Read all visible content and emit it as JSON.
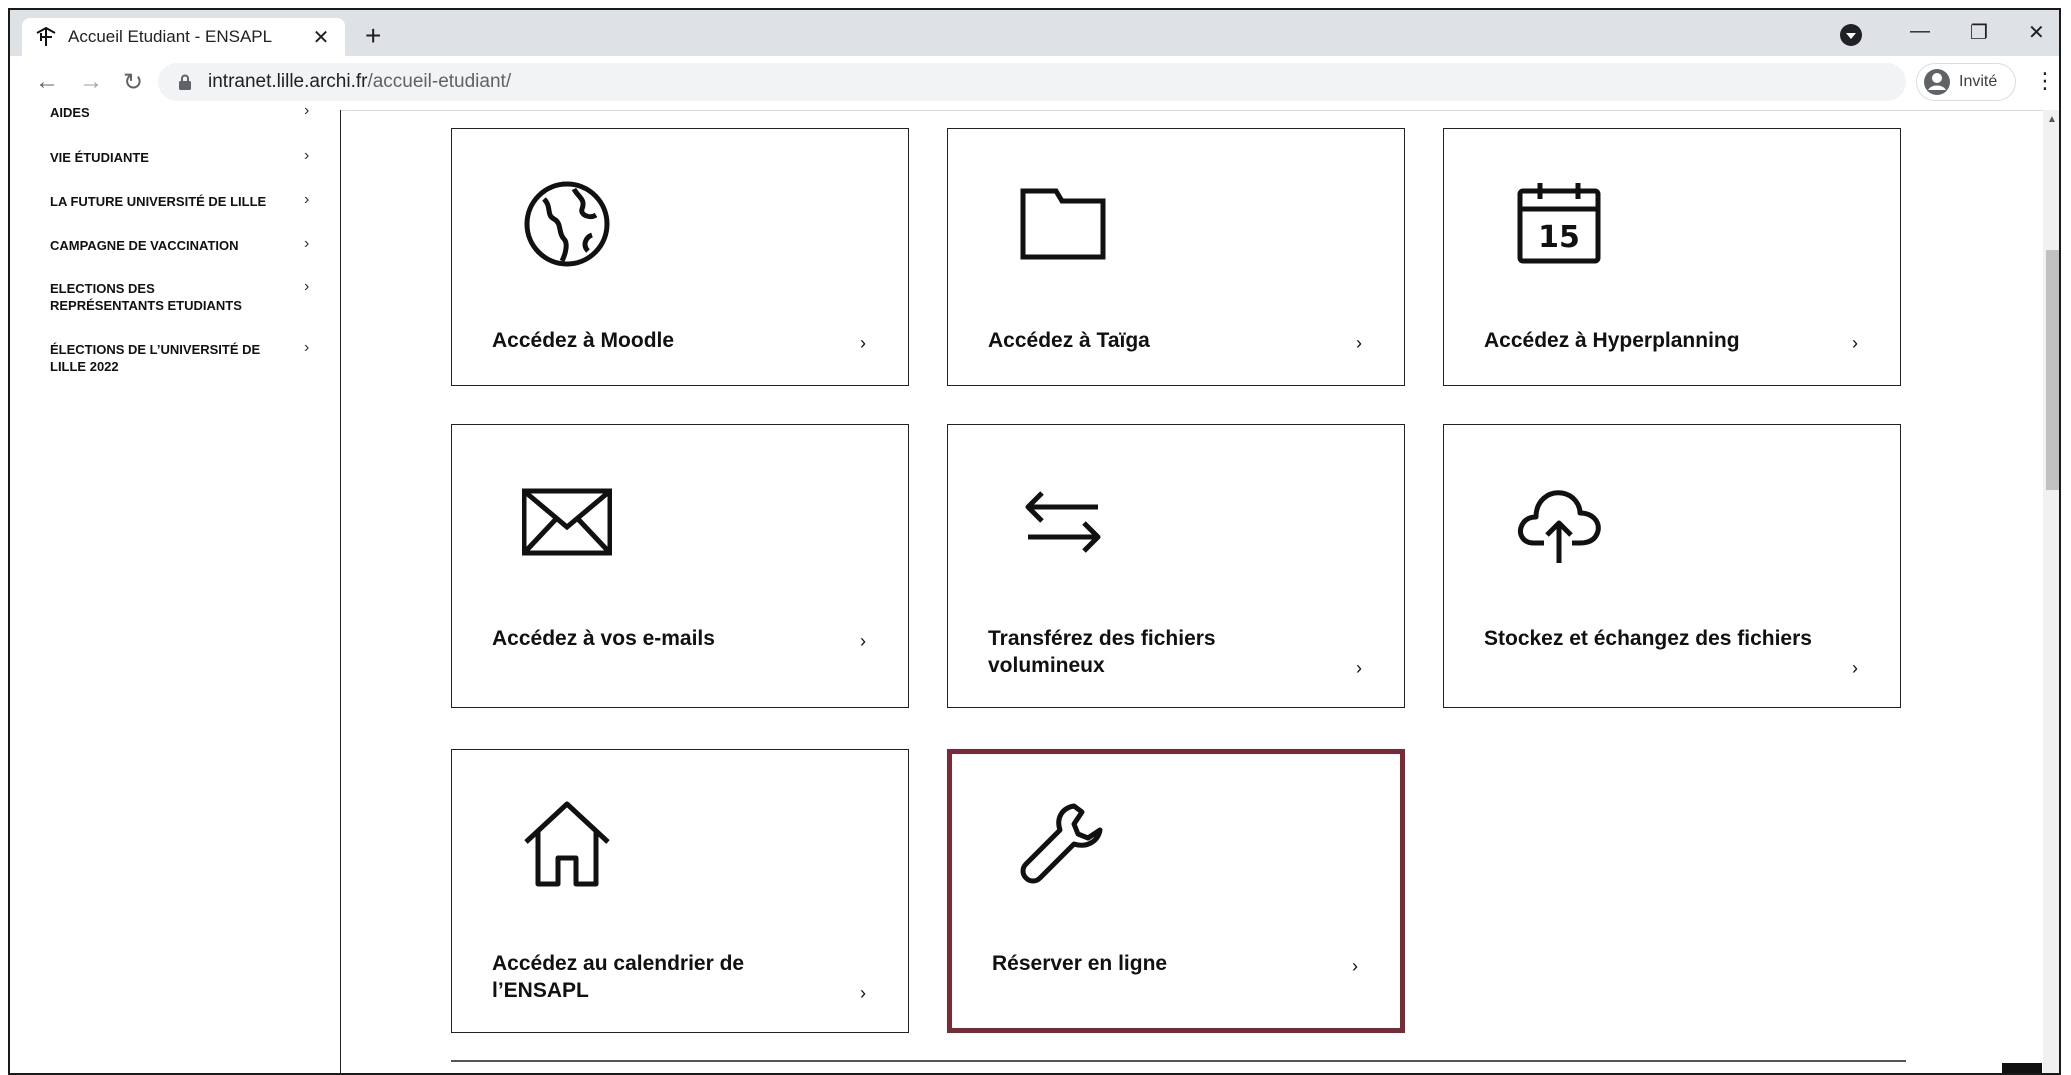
{
  "browser": {
    "tab_title": "Accueil Etudiant - ENSAPL",
    "tab_close": "✕",
    "new_tab": "+",
    "url_host": "intranet.lille.archi.fr",
    "url_path": "/accueil-etudiant/",
    "guest_label": "Invité",
    "min": "—",
    "max": "❐",
    "close": "✕",
    "back": "←",
    "forward": "→",
    "reload": "↻",
    "menu": "⋮"
  },
  "sidebar": {
    "items": [
      {
        "label": "AIDES"
      },
      {
        "label": "VIE ÉTUDIANTE"
      },
      {
        "label": "LA FUTURE UNIVERSITÉ DE LILLE"
      },
      {
        "label": "CAMPAGNE DE VACCINATION"
      },
      {
        "label": "ELECTIONS DES REPRÉSENTANTS ETUDIANTS"
      },
      {
        "label": "ÉLECTIONS DE L’UNIVERSITÉ DE LILLE 2022"
      }
    ],
    "chevron": "›"
  },
  "cards": [
    {
      "label": "Accédez à Moodle",
      "icon": "globe-icon"
    },
    {
      "label": "Accédez à Taïga",
      "icon": "folder-icon"
    },
    {
      "label": "Accédez à Hyperplanning",
      "icon": "calendar-icon",
      "calendar_day": "15"
    },
    {
      "label": "Accédez à vos e-mails",
      "icon": "envelope-icon"
    },
    {
      "label": "Transférez des fichiers volumineux",
      "icon": "transfer-arrows-icon"
    },
    {
      "label": "Stockez et échangez des fichiers",
      "icon": "cloud-upload-icon"
    },
    {
      "label": "Accédez au calendrier de l’ENSAPL",
      "icon": "house-icon"
    },
    {
      "label": "Réserver en ligne",
      "icon": "wrench-icon"
    }
  ],
  "card_arrow": "›",
  "colors": {
    "highlight_border": "#7a2a36",
    "card_border": "#222222"
  }
}
